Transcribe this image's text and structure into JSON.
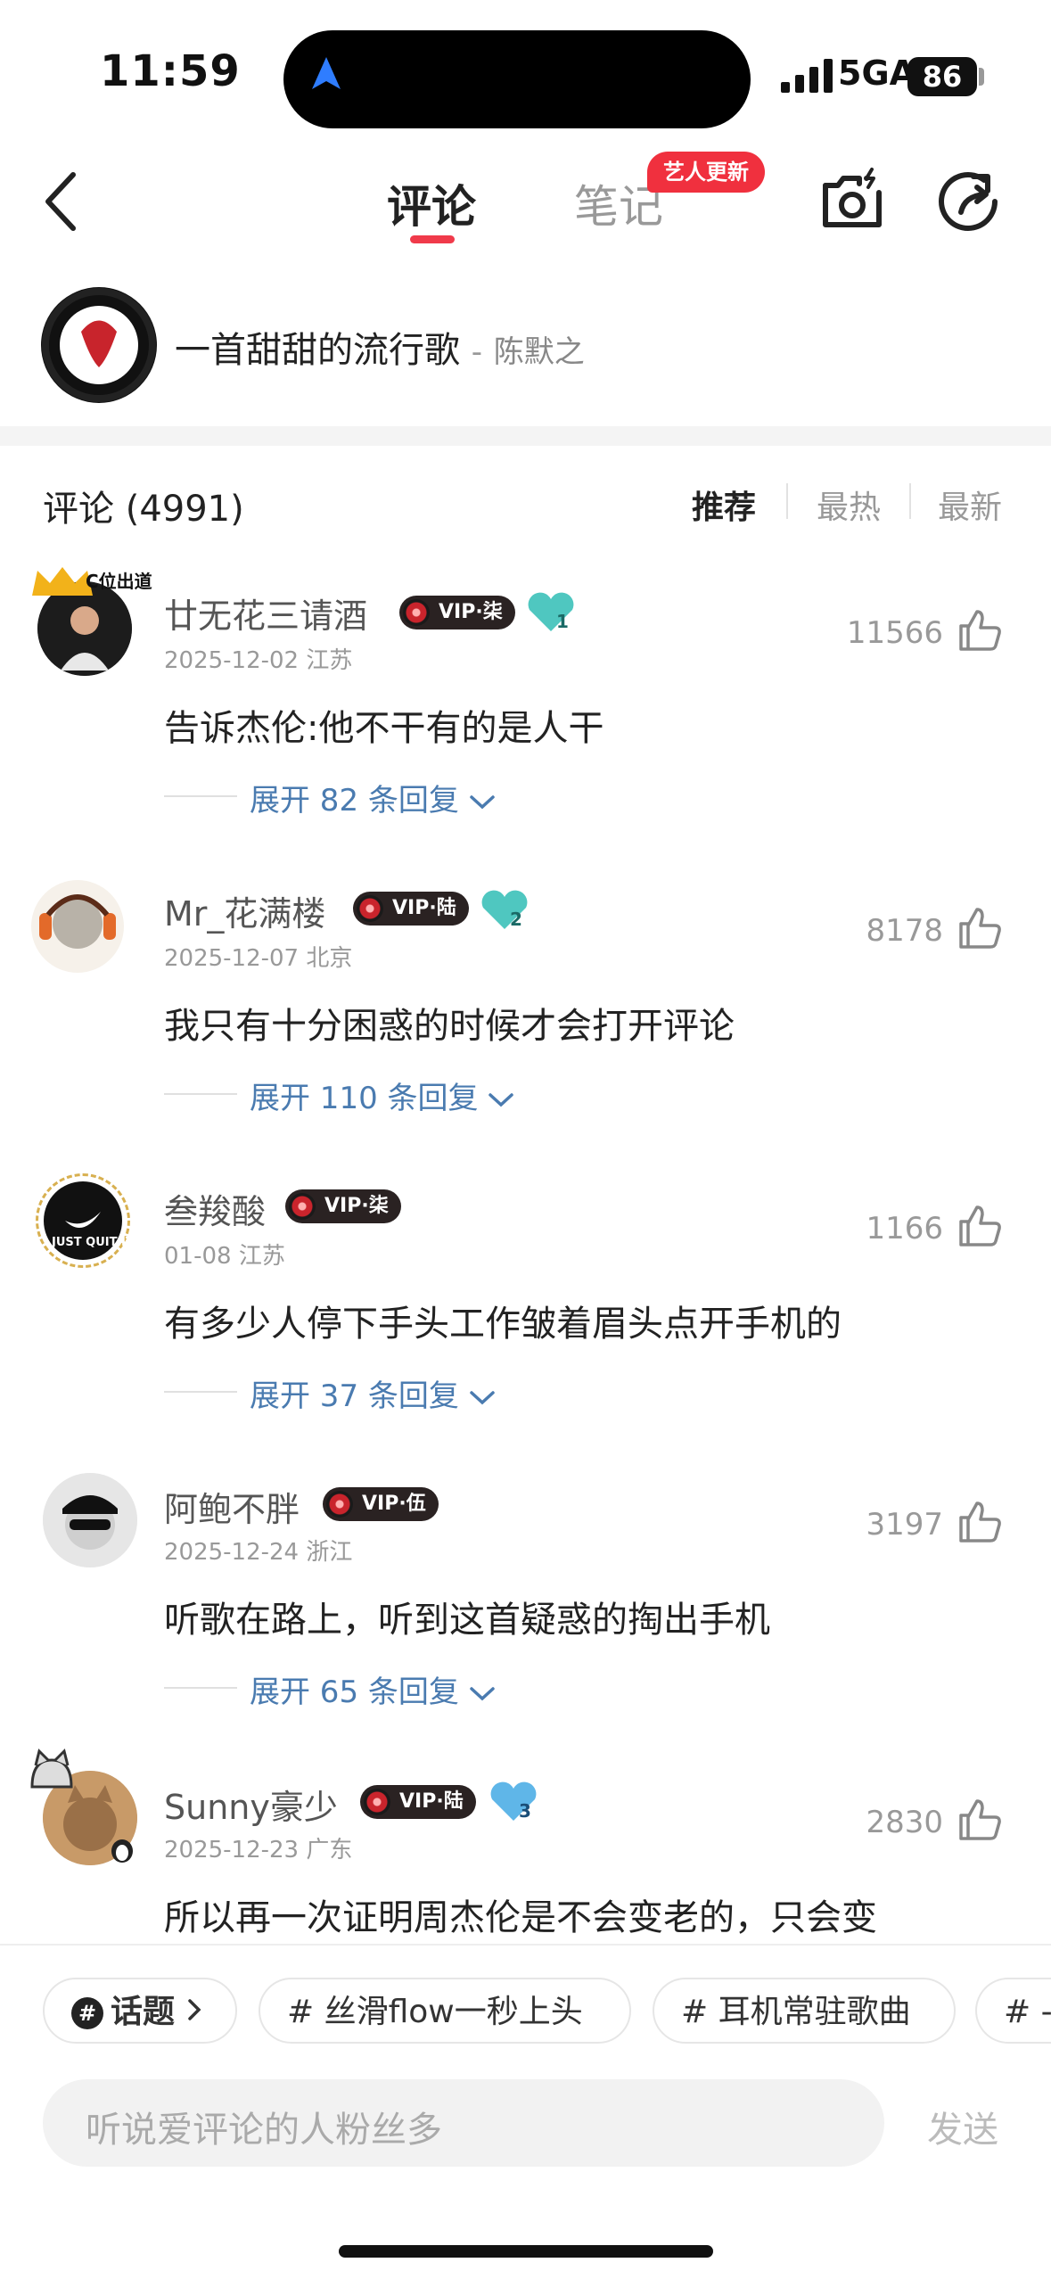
{
  "status_bar": {
    "time": "11:59",
    "network": "5GA",
    "battery": "86"
  },
  "header": {
    "tab_comments": "评论",
    "tab_notes": "笔记",
    "badge": "艺人更新"
  },
  "song": {
    "title": "一首甜甜的流行歌",
    "separator": "-",
    "artist": "陈默之"
  },
  "comments_header": {
    "title": "评论 (4991)",
    "sort_recommended": "推荐",
    "sort_hot": "最热",
    "sort_new": "最新"
  },
  "comments": [
    {
      "user": "廿无花三请酒",
      "vip": "VIP·柒",
      "heart_level": "1",
      "meta": "2025-12-02 江苏",
      "likes": "11566",
      "text": "告诉杰伦:他不干有的是人干",
      "replies": "展开 82 条回复"
    },
    {
      "user": "Mr_花满楼",
      "vip": "VIP·陆",
      "heart_level": "2",
      "meta": "2025-12-07 北京",
      "likes": "8178",
      "text": "我只有十分困惑的时候才会打开评论",
      "replies": "展开 110 条回复"
    },
    {
      "user": "叁羧酸",
      "vip": "VIP·柒",
      "meta": "01-08 江苏",
      "likes": "1166",
      "text": "有多少人停下手头工作皱着眉头点开手机的",
      "replies": "展开 37 条回复"
    },
    {
      "user": "阿鲍不胖",
      "vip": "VIP·伍",
      "meta": "2025-12-24 浙江",
      "likes": "3197",
      "text": "听歌在路上，听到这首疑惑的掏出手机",
      "replies": "展开 65 条回复"
    },
    {
      "user": "Sunny豪少",
      "vip": "VIP·陆",
      "heart_level": "3",
      "meta": "2025-12-23 广东",
      "likes": "2830",
      "text": "所以再一次证明周杰伦是不会变老的，只会变"
    }
  ],
  "avatar_texts": {
    "c1": "C位出道",
    "c3": "JUST QUIT IT."
  },
  "chips": [
    {
      "label": "话题"
    },
    {
      "label": "# 丝滑flow一秒上头"
    },
    {
      "label": "# 耳机常驻歌曲"
    },
    {
      "label": "# -"
    }
  ],
  "input": {
    "placeholder": "听说爱评论的人粉丝多",
    "send": "发送"
  },
  "colors": {
    "accent": "#f03a4a",
    "link": "#4a7bb0",
    "muted": "#999999"
  }
}
